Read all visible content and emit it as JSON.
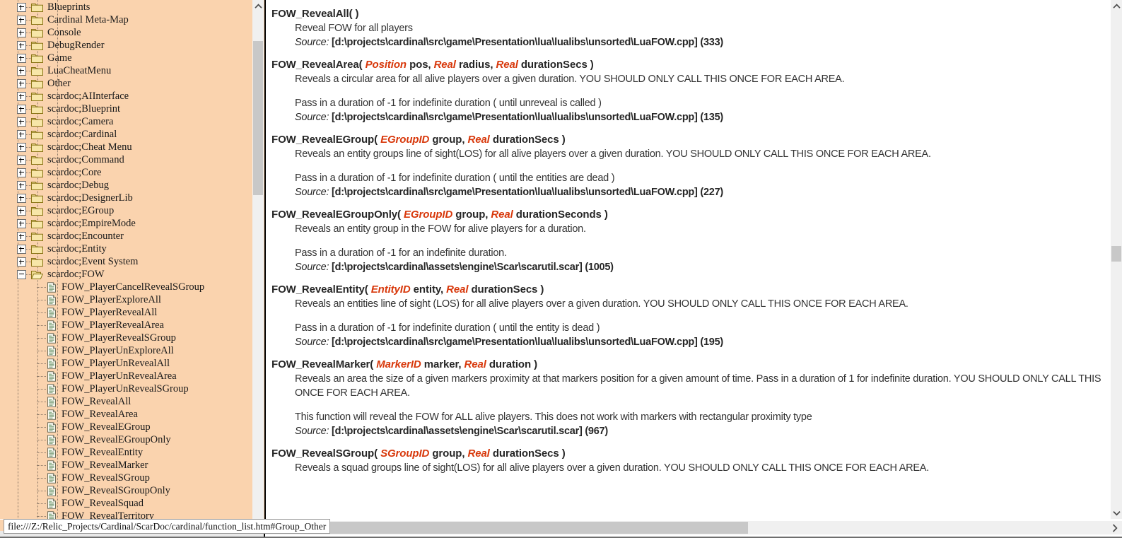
{
  "status_bar": {
    "url": "file:///Z:/Relic_Projects/Cardinal/ScarDoc/cardinal/function_list.htm#Group_Other"
  },
  "tree": {
    "groups": [
      {
        "label": "Blueprints",
        "depth": 1,
        "type": "folder",
        "state": "collapsed"
      },
      {
        "label": "Cardinal Meta-Map",
        "depth": 1,
        "type": "folder",
        "state": "collapsed"
      },
      {
        "label": "Console",
        "depth": 1,
        "type": "folder",
        "state": "collapsed"
      },
      {
        "label": "DebugRender",
        "depth": 1,
        "type": "folder",
        "state": "collapsed"
      },
      {
        "label": "Game",
        "depth": 1,
        "type": "folder",
        "state": "collapsed"
      },
      {
        "label": "LuaCheatMenu",
        "depth": 1,
        "type": "folder",
        "state": "collapsed"
      },
      {
        "label": "Other",
        "depth": 1,
        "type": "folder",
        "state": "collapsed"
      },
      {
        "label": "scardoc;AIInterface",
        "depth": 1,
        "type": "folder",
        "state": "collapsed"
      },
      {
        "label": "scardoc;Blueprint",
        "depth": 1,
        "type": "folder",
        "state": "collapsed"
      },
      {
        "label": "scardoc;Camera",
        "depth": 1,
        "type": "folder",
        "state": "collapsed"
      },
      {
        "label": "scardoc;Cardinal",
        "depth": 1,
        "type": "folder",
        "state": "collapsed"
      },
      {
        "label": "scardoc;Cheat Menu",
        "depth": 1,
        "type": "folder",
        "state": "collapsed"
      },
      {
        "label": "scardoc;Command",
        "depth": 1,
        "type": "folder",
        "state": "collapsed"
      },
      {
        "label": "scardoc;Core",
        "depth": 1,
        "type": "folder",
        "state": "collapsed"
      },
      {
        "label": "scardoc;Debug",
        "depth": 1,
        "type": "folder",
        "state": "collapsed"
      },
      {
        "label": "scardoc;DesignerLib",
        "depth": 1,
        "type": "folder",
        "state": "collapsed"
      },
      {
        "label": "scardoc;EGroup",
        "depth": 1,
        "type": "folder",
        "state": "collapsed"
      },
      {
        "label": "scardoc;EmpireMode",
        "depth": 1,
        "type": "folder",
        "state": "collapsed"
      },
      {
        "label": "scardoc;Encounter",
        "depth": 1,
        "type": "folder",
        "state": "collapsed"
      },
      {
        "label": "scardoc;Entity",
        "depth": 1,
        "type": "folder",
        "state": "collapsed"
      },
      {
        "label": "scardoc;Event System",
        "depth": 1,
        "type": "folder",
        "state": "collapsed"
      },
      {
        "label": "scardoc;FOW",
        "depth": 1,
        "type": "folder",
        "state": "expanded"
      },
      {
        "label": "FOW_PlayerCancelRevealSGroup",
        "depth": 2,
        "type": "page"
      },
      {
        "label": "FOW_PlayerExploreAll",
        "depth": 2,
        "type": "page"
      },
      {
        "label": "FOW_PlayerRevealAll",
        "depth": 2,
        "type": "page"
      },
      {
        "label": "FOW_PlayerRevealArea",
        "depth": 2,
        "type": "page"
      },
      {
        "label": "FOW_PlayerRevealSGroup",
        "depth": 2,
        "type": "page"
      },
      {
        "label": "FOW_PlayerUnExploreAll",
        "depth": 2,
        "type": "page"
      },
      {
        "label": "FOW_PlayerUnRevealAll",
        "depth": 2,
        "type": "page"
      },
      {
        "label": "FOW_PlayerUnRevealArea",
        "depth": 2,
        "type": "page"
      },
      {
        "label": "FOW_PlayerUnRevealSGroup",
        "depth": 2,
        "type": "page"
      },
      {
        "label": "FOW_RevealAll",
        "depth": 2,
        "type": "page"
      },
      {
        "label": "FOW_RevealArea",
        "depth": 2,
        "type": "page"
      },
      {
        "label": "FOW_RevealEGroup",
        "depth": 2,
        "type": "page"
      },
      {
        "label": "FOW_RevealEGroupOnly",
        "depth": 2,
        "type": "page"
      },
      {
        "label": "FOW_RevealEntity",
        "depth": 2,
        "type": "page"
      },
      {
        "label": "FOW_RevealMarker",
        "depth": 2,
        "type": "page"
      },
      {
        "label": "FOW_RevealSGroup",
        "depth": 2,
        "type": "page"
      },
      {
        "label": "FOW_RevealSGroupOnly",
        "depth": 2,
        "type": "page"
      },
      {
        "label": "FOW_RevealSquad",
        "depth": 2,
        "type": "page"
      },
      {
        "label": "FOW_RevealTerritory",
        "depth": 2,
        "type": "page"
      }
    ]
  },
  "doc": {
    "source_keyword": "Source:",
    "functions": [
      {
        "name": "FOW_RevealAll",
        "sig_parts": [
          {
            "text": "FOW_RevealAll( )",
            "kind": "plain"
          }
        ],
        "paragraphs": [
          "Reveal FOW for all players"
        ],
        "source_path": "[d:\\projects\\cardinal\\src\\game\\Presentation\\lua\\lualibs\\unsorted\\LuaFOW.cpp] (333)"
      },
      {
        "name": "FOW_RevealArea",
        "sig_parts": [
          {
            "text": "FOW_RevealArea( ",
            "kind": "plain"
          },
          {
            "text": "Position",
            "kind": "type"
          },
          {
            "text": " pos, ",
            "kind": "plain"
          },
          {
            "text": "Real",
            "kind": "type"
          },
          {
            "text": " radius, ",
            "kind": "plain"
          },
          {
            "text": "Real",
            "kind": "type"
          },
          {
            "text": " durationSecs )",
            "kind": "plain"
          }
        ],
        "paragraphs": [
          "Reveals a circular area for all alive players over a given duration. YOU SHOULD ONLY CALL THIS ONCE FOR EACH AREA.",
          "Pass in a duration of -1 for indefinite duration ( until unreveal is called )"
        ],
        "source_path": "[d:\\projects\\cardinal\\src\\game\\Presentation\\lua\\lualibs\\unsorted\\LuaFOW.cpp] (135)"
      },
      {
        "name": "FOW_RevealEGroup",
        "sig_parts": [
          {
            "text": "FOW_RevealEGroup( ",
            "kind": "plain"
          },
          {
            "text": "EGroupID",
            "kind": "type"
          },
          {
            "text": " group, ",
            "kind": "plain"
          },
          {
            "text": "Real",
            "kind": "type"
          },
          {
            "text": " durationSecs )",
            "kind": "plain"
          }
        ],
        "paragraphs": [
          "Reveals an entity groups line of sight(LOS) for all alive players over a given duration. YOU SHOULD ONLY CALL THIS ONCE FOR EACH AREA.",
          "Pass in a duration of -1 for indefinite duration ( until the entities are dead )"
        ],
        "source_path": "[d:\\projects\\cardinal\\src\\game\\Presentation\\lua\\lualibs\\unsorted\\LuaFOW.cpp] (227)"
      },
      {
        "name": "FOW_RevealEGroupOnly",
        "sig_parts": [
          {
            "text": "FOW_RevealEGroupOnly( ",
            "kind": "plain"
          },
          {
            "text": "EGroupID",
            "kind": "type"
          },
          {
            "text": " group, ",
            "kind": "plain"
          },
          {
            "text": "Real",
            "kind": "type"
          },
          {
            "text": " durationSeconds )",
            "kind": "plain"
          }
        ],
        "paragraphs": [
          "Reveals an entity group in the FOW for alive players for a duration.",
          "Pass in a duration of -1 for an indefinite duration."
        ],
        "source_path": "[d:\\projects\\cardinal\\assets\\engine\\Scar\\scarutil.scar] (1005)"
      },
      {
        "name": "FOW_RevealEntity",
        "sig_parts": [
          {
            "text": "FOW_RevealEntity( ",
            "kind": "plain"
          },
          {
            "text": "EntityID",
            "kind": "type"
          },
          {
            "text": " entity, ",
            "kind": "plain"
          },
          {
            "text": "Real",
            "kind": "type"
          },
          {
            "text": " durationSecs )",
            "kind": "plain"
          }
        ],
        "paragraphs": [
          "Reveals an entities line of sight (LOS) for all alive players over a given duration. YOU SHOULD ONLY CALL THIS ONCE FOR EACH AREA.",
          "Pass in a duration of -1 for indefinite duration ( until the entity is dead )"
        ],
        "source_path": "[d:\\projects\\cardinal\\src\\game\\Presentation\\lua\\lualibs\\unsorted\\LuaFOW.cpp] (195)"
      },
      {
        "name": "FOW_RevealMarker",
        "sig_parts": [
          {
            "text": "FOW_RevealMarker( ",
            "kind": "plain"
          },
          {
            "text": "MarkerID",
            "kind": "type"
          },
          {
            "text": " marker, ",
            "kind": "plain"
          },
          {
            "text": "Real",
            "kind": "type"
          },
          {
            "text": " duration )",
            "kind": "plain"
          }
        ],
        "paragraphs": [
          "Reveals an area the size of a given markers proximity at that markers position for a given amount of time. Pass in a duration of 1 for indefinite duration. YOU SHOULD ONLY CALL THIS ONCE FOR EACH AREA.",
          "This function will reveal the FOW for ALL alive players. This does not work with markers with rectangular proximity type"
        ],
        "source_path": "[d:\\projects\\cardinal\\assets\\engine\\Scar\\scarutil.scar] (967)"
      },
      {
        "name": "FOW_RevealSGroup",
        "sig_parts": [
          {
            "text": "FOW_RevealSGroup( ",
            "kind": "plain"
          },
          {
            "text": "SGroupID",
            "kind": "type"
          },
          {
            "text": " group, ",
            "kind": "plain"
          },
          {
            "text": "Real",
            "kind": "type"
          },
          {
            "text": " durationSecs )",
            "kind": "plain"
          }
        ],
        "paragraphs": [
          "Reveals a squad groups line of sight(LOS) for all alive players over a given duration. YOU SHOULD ONLY CALL THIS ONCE FOR EACH AREA."
        ],
        "source_path": ""
      }
    ]
  },
  "icons": {
    "scroll_up": "chevron-up-icon",
    "scroll_down": "chevron-down-icon",
    "scroll_right": "chevron-right-icon"
  }
}
